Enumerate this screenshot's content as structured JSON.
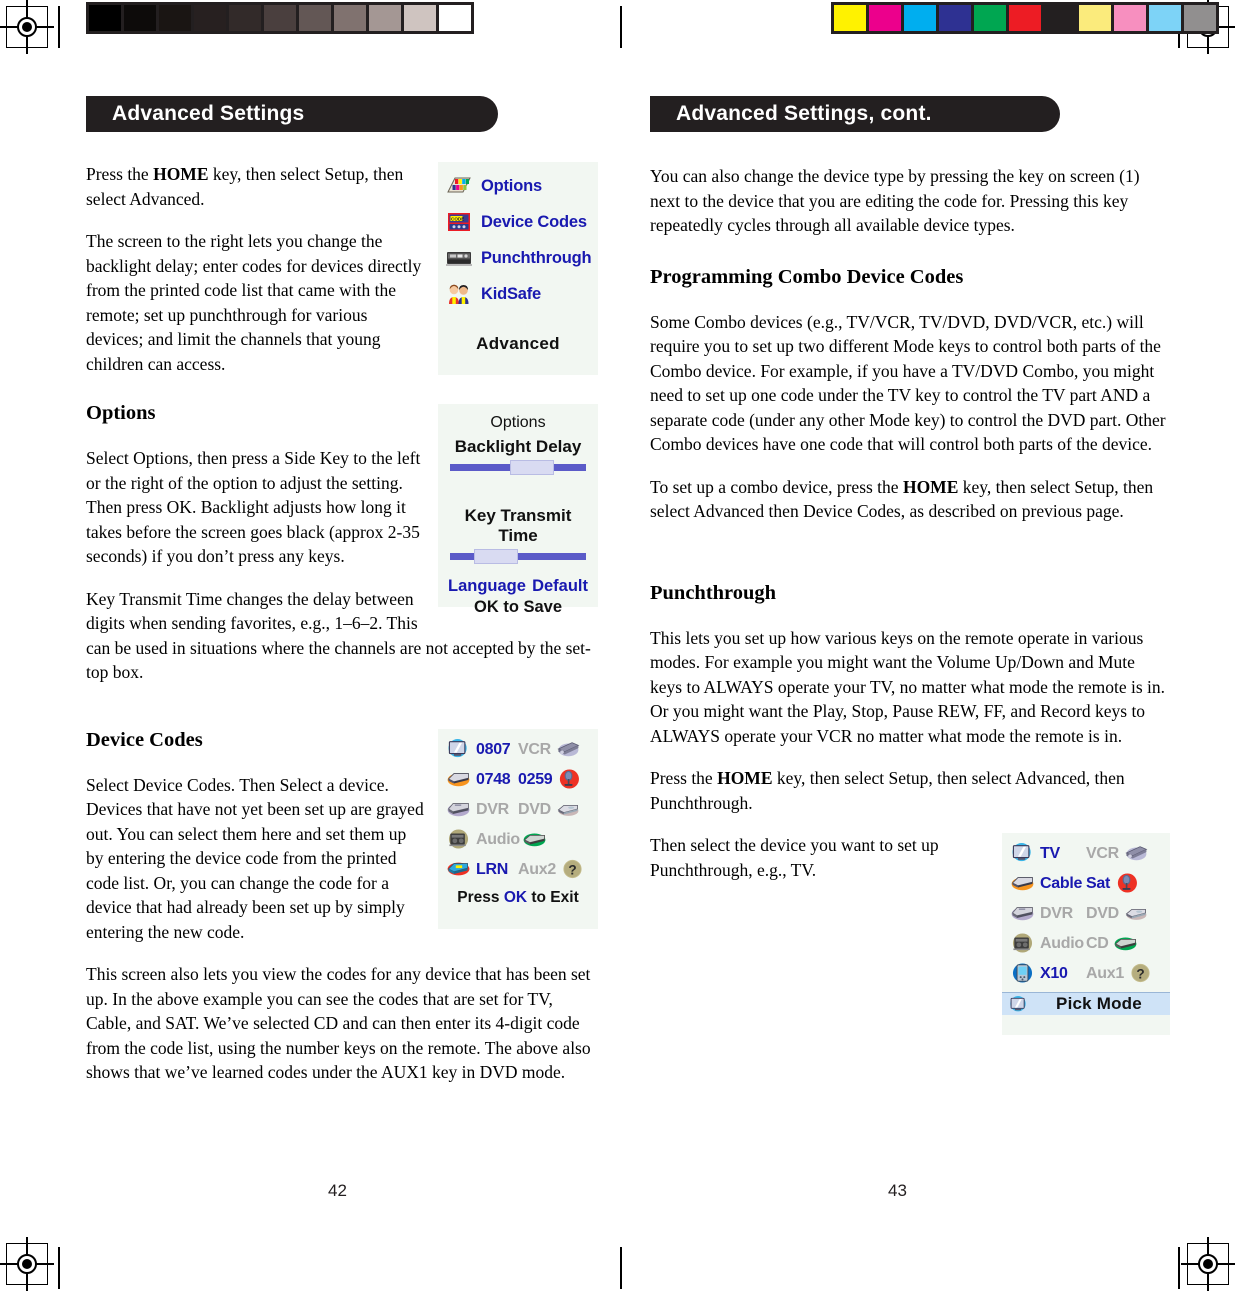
{
  "print_marks": {
    "grayscale_swatches": [
      "#000000",
      "#0d0b0a",
      "#1a1513",
      "#272020",
      "#322a29",
      "#4a3f3e",
      "#635755",
      "#80726f",
      "#a49794",
      "#cfc4c0",
      "#ffffff"
    ],
    "color_swatches": [
      "#fff200",
      "#ec008c",
      "#00aeef",
      "#2e3192",
      "#00a651",
      "#ed1c24",
      "#231f20",
      "#fbeb7c",
      "#f78fbf",
      "#7dd3f7",
      "#918f8f"
    ],
    "registration_icon": "registration-target-icon"
  },
  "left_page": {
    "banner": "Advanced Settings",
    "page_number": "42",
    "paragraphs": {
      "intro_1_a": "Press the ",
      "intro_1_b": "HOME",
      "intro_1_c": " key, then select Setup, then select Advanced.",
      "intro_2": "The screen to the right lets you change the backlight delay; enter codes for devices directly from the printed code list that came with the remote; set up punchthrough for various devices; and limit the channels that young children can access."
    },
    "options_section": {
      "heading": "Options",
      "body_1": "Select Options, then press a Side Key to the left or the right of the option to adjust the setting. Then press OK. Backlight adjusts how long it takes before the screen goes black (approx 2-35 seconds) if you don’t press any keys.",
      "body_2": "Key Transmit Time changes the delay between digits when sending favorites, e.g., 1–6–2. This can be used in situations where the channels are not accepted by the set-top box."
    },
    "device_codes_section": {
      "heading": "Device Codes",
      "body_1": "Select Device Codes. Then Select a device. Devices that have not yet been set up are grayed out. You can select them here and set them up by entering the device code from the printed code list. Or, you can change the code for a device that had already been set up by simply entering the new code.",
      "body_2": "This screen also lets you view the codes for any device that has been set up. In the above example you can see the codes that are set for TV, Cable, and SAT. We’ve selected CD and can then enter its 4-digit code from the code list, using the number keys on the remote. The above also shows that we’ve learned codes under the AUX1 key in DVD mode."
    },
    "menu_screen": {
      "items": [
        {
          "label": "Options",
          "icon": "options-palette-icon"
        },
        {
          "label": "Device Codes",
          "icon": "code-keypad-icon"
        },
        {
          "label": "Punchthrough",
          "icon": "av-receiver-icon"
        },
        {
          "label": "KidSafe",
          "icon": "kids-icon"
        }
      ],
      "footer": "Advanced"
    },
    "options_screen": {
      "title": "Options",
      "slider_1_label": "Backlight Delay",
      "slider_1_value": 44,
      "slider_2_label": "Key Transmit Time",
      "slider_2_value": 18,
      "link_left": "Language",
      "link_right": "Default",
      "footer": "OK to Save"
    },
    "device_codes_screen": {
      "rows": [
        [
          {
            "text": "0807",
            "state": "on",
            "icon": "tv-icon",
            "icon_side": "left"
          },
          {
            "text": "VCR",
            "state": "off",
            "icon": "vcr-icon",
            "icon_side": "right"
          }
        ],
        [
          {
            "text": "0748",
            "state": "on",
            "icon": "cable-icon",
            "icon_side": "left"
          },
          {
            "text": "0259",
            "state": "on",
            "icon": "sat-icon",
            "icon_side": "right"
          }
        ],
        [
          {
            "text": "DVR",
            "state": "off",
            "icon": "dvr-icon",
            "icon_side": "left"
          },
          {
            "text": "DVD",
            "state": "off",
            "icon": "dvd-icon",
            "icon_side": "right"
          }
        ],
        [
          {
            "text": "Audio",
            "state": "off",
            "icon": "audio-icon",
            "icon_side": "left"
          },
          {
            "text": "",
            "state": "off",
            "icon": "cd-icon",
            "icon_side": "right"
          }
        ],
        [
          {
            "text": "LRN",
            "state": "on",
            "icon": "learn-icon",
            "icon_side": "left"
          },
          {
            "text": "Aux2",
            "state": "off",
            "icon": "help-icon",
            "icon_side": "right"
          }
        ]
      ],
      "footer_before": "Press ",
      "footer_ok": "OK",
      "footer_after": " to Exit"
    }
  },
  "right_page": {
    "banner": "Advanced Settings, cont.",
    "page_number": "43",
    "paragraphs": {
      "intro": "You can also change the device type by pressing the key on screen (1) next to the device that you are editing the code for. Pressing this key repeatedly cycles through all available device types."
    },
    "combo_section": {
      "heading": "Programming Combo Device Codes",
      "body_1": "Some Combo devices (e.g., TV/VCR, TV/DVD, DVD/VCR, etc.) will require you to set up two different Mode keys to control both parts of the Combo device. For example, if you have a TV/DVD Combo, you might need to set up one code under the TV key to control the TV part AND a separate code (under any other Mode key) to control the DVD part. Other Combo devices have one code that will control both parts of the device.",
      "body_2_a": "To set up a combo device, press the ",
      "body_2_b": "HOME",
      "body_2_c": " key, then select Setup, then select Advanced then Device Codes, as described on previous page."
    },
    "punchthrough_section": {
      "heading": "Punchthrough",
      "body_1": "This lets you set up how various keys on the remote operate in various modes. For example you might want the Volume Up/Down and Mute keys to ALWAYS operate your TV, no matter what mode the remote is in. Or you might want the Play, Stop, Pause REW, FF, and Record keys to ALWAYS operate your VCR no matter what mode the remote is in.",
      "body_2_a": "Press the ",
      "body_2_b": "HOME",
      "body_2_c": " key, then select Setup, then select Advanced, then Punchthrough.",
      "body_3": "Then select the device you want to set up Punchthrough, e.g., TV."
    },
    "punchthrough_screen": {
      "rows": [
        [
          {
            "text": "TV",
            "state": "on",
            "icon": "tv-icon",
            "icon_side": "left"
          },
          {
            "text": "VCR",
            "state": "off",
            "icon": "vcr-icon",
            "icon_side": "right"
          }
        ],
        [
          {
            "text": "Cable",
            "state": "on",
            "icon": "cable-icon",
            "icon_side": "left"
          },
          {
            "text": "Sat",
            "state": "on",
            "icon": "sat-icon",
            "icon_side": "right"
          }
        ],
        [
          {
            "text": "DVR",
            "state": "off",
            "icon": "dvr-icon",
            "icon_side": "left"
          },
          {
            "text": "DVD",
            "state": "off",
            "icon": "dvd-icon",
            "icon_side": "right"
          }
        ],
        [
          {
            "text": "Audio",
            "state": "off",
            "icon": "audio-icon",
            "icon_side": "left"
          },
          {
            "text": "CD",
            "state": "off",
            "icon": "cd-icon",
            "icon_side": "right"
          }
        ],
        [
          {
            "text": "X10",
            "state": "on",
            "icon": "x10-icon",
            "icon_side": "left"
          },
          {
            "text": "Aux1",
            "state": "off",
            "icon": "help-icon",
            "icon_side": "right"
          }
        ]
      ],
      "pick_mode_label": "Pick Mode",
      "pick_mode_icon": "tv-icon"
    }
  }
}
